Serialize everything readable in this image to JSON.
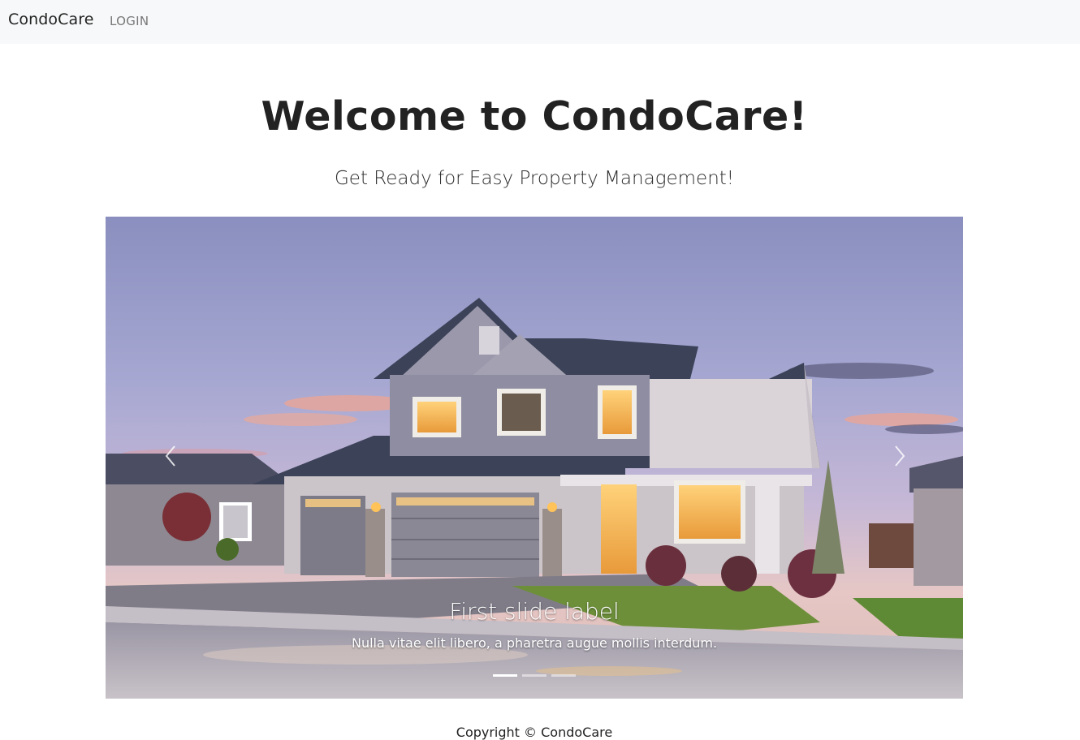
{
  "navbar": {
    "brand": "CondoCare",
    "links": [
      "LOGIN"
    ]
  },
  "hero": {
    "title": "Welcome to CondoCare!",
    "subtitle": "Get Ready for Easy Property Management!"
  },
  "carousel": {
    "active_index": 0,
    "slide_count": 3,
    "caption_title": "First slide label",
    "caption_text": "Nulla vitae elit libero, a pharetra augue mollis interdum.",
    "prev_icon": "chevron-left-icon",
    "next_icon": "chevron-right-icon"
  },
  "footer": {
    "copyright": "Copyright © CondoCare"
  },
  "colors": {
    "navbar_bg": "#f7f8f9",
    "text": "#222222",
    "nav_link": "#777777"
  }
}
